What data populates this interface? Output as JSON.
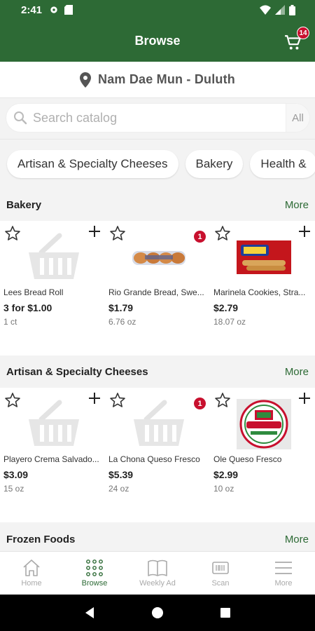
{
  "status_bar": {
    "time": "2:41"
  },
  "app_bar": {
    "title": "Browse",
    "cart_count": "14"
  },
  "store": {
    "name": "Nam Dae Mun - Duluth"
  },
  "search": {
    "placeholder": "Search catalog",
    "scope": "All"
  },
  "chips": [
    "Artisan & Specialty Cheeses",
    "Bakery",
    "Health &"
  ],
  "sections": [
    {
      "title": "Bakery",
      "more": "More",
      "products": [
        {
          "name": "Lees Bread Roll",
          "price": "3 for $1.00",
          "size": "1 ct",
          "badge": "",
          "image": "basket-placeholder"
        },
        {
          "name": "Rio Grande Bread, Swe...",
          "price": "$1.79",
          "size": "6.76 oz",
          "badge": "1",
          "image": "bread-rolls"
        },
        {
          "name": "Marinela Cookies, Stra...",
          "price": "$2.79",
          "size": "18.07 oz",
          "badge": "",
          "image": "cookie-box"
        }
      ]
    },
    {
      "title": "Artisan & Specialty Cheeses",
      "more": "More",
      "products": [
        {
          "name": "Playero Crema Salvado...",
          "price": "$3.09",
          "size": "15 oz",
          "badge": "",
          "image": "basket-placeholder"
        },
        {
          "name": "La Chona Queso Fresco",
          "price": "$5.39",
          "size": "24 oz",
          "badge": "1",
          "image": "basket-placeholder"
        },
        {
          "name": "Ole Queso Fresco",
          "price": "$2.99",
          "size": "10 oz",
          "badge": "",
          "image": "queso-fresco"
        }
      ]
    },
    {
      "title": "Frozen Foods",
      "more": "More"
    }
  ],
  "bottom_nav": [
    {
      "label": "Home",
      "icon": "home-icon"
    },
    {
      "label": "Browse",
      "icon": "grid-icon",
      "active": true
    },
    {
      "label": "Weekly Ad",
      "icon": "book-icon"
    },
    {
      "label": "Scan",
      "icon": "barcode-icon"
    },
    {
      "label": "More",
      "icon": "menu-icon"
    }
  ],
  "colors": {
    "brand": "#2d6a35",
    "badge": "#c8102e"
  }
}
